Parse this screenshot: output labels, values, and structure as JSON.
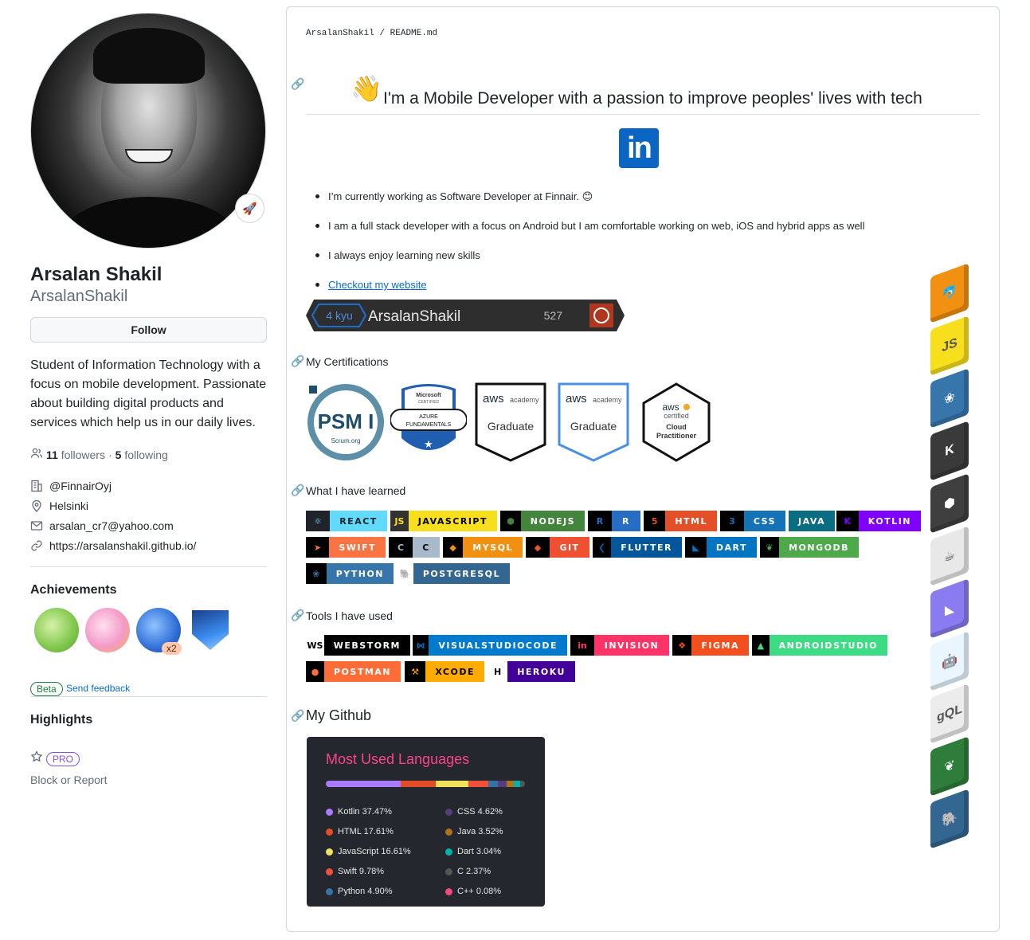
{
  "profile": {
    "name": "Arsalan Shakil",
    "login": "ArsalanShakil",
    "follow_label": "Follow",
    "bio": "Student of Information Technology with a focus on mobile development. Passionate about building digital products and services which help us in our daily lives.",
    "followers_count": "11",
    "followers_label": "followers",
    "following_count": "5",
    "following_label": "following",
    "separator": "·",
    "company": "@FinnairOyj",
    "location": "Helsinki",
    "email": "arsalan_cr7@yahoo.com",
    "website": "https://arsalanshakil.github.io/",
    "achievements_title": "Achievements",
    "achievement_multiplier": "x2",
    "beta_label": "Beta",
    "feedback_label": "Send feedback",
    "highlights_title": "Highlights",
    "pro_label": "PRO",
    "block_label": "Block or Report"
  },
  "readme": {
    "breadcrumb_user": "ArsalanShakil",
    "breadcrumb_sep": "/",
    "breadcrumb_file": "README.md",
    "wave_emoji": "👋",
    "headline": "I'm a Mobile Developer with a passion to improve peoples' lives with tech",
    "linkedin_label": "in",
    "bullets": [
      "I’m currently working as Software Developer at Finnair. 😊",
      "I am a full stack developer with a focus on Android but I am comfortable working on web, iOS and hybrid apps as well",
      "I always enjoy learning new skills"
    ],
    "website_link": "Checkout my website",
    "codewars": {
      "rank": "4 kyu",
      "user": "ArsalanShakil",
      "score": "527"
    },
    "certifications_title": "My Certifications",
    "certs": {
      "psm": "PSM I",
      "psm_org": "Scrum.org",
      "azure_ms": "Microsoft",
      "azure_certified": "CERTIFIED",
      "azure_name1": "AZURE",
      "azure_name2": "FUNDAMENTALS",
      "aws": "aws",
      "aws_academy": "academy",
      "aws_graduate": "Graduate",
      "aws_certified": "certified",
      "aws_cloud": "Cloud",
      "aws_practitioner": "Practitioner"
    },
    "learned_title": "What I have learned",
    "learned": [
      {
        "label": "REACT",
        "logo": "⚛",
        "logo_bg": "#20232a",
        "bg": "#61dafb",
        "fg": "#20232a"
      },
      {
        "label": "JAVASCRIPT",
        "logo": "JS",
        "logo_bg": "#323330",
        "bg": "#f7df1e",
        "fg": "#000000"
      },
      {
        "label": "NODEJS",
        "logo": "⬢",
        "logo_bg": "#000000",
        "bg": "#43853d",
        "fg": "#ffffff"
      },
      {
        "label": "R",
        "logo": "R",
        "logo_bg": "#000000",
        "bg": "#276dc3",
        "fg": "#ffffff"
      },
      {
        "label": "HTML",
        "logo": "5",
        "logo_bg": "#000000",
        "bg": "#e34f26",
        "fg": "#ffffff"
      },
      {
        "label": "CSS",
        "logo": "3",
        "logo_bg": "#000000",
        "bg": "#1572b6",
        "fg": "#ffffff"
      },
      {
        "label": "JAVA",
        "logo": "",
        "logo_bg": "#0a6d82",
        "bg": "#0a6d82",
        "fg": "#ffffff"
      },
      {
        "label": "KOTLIN",
        "logo": "K",
        "logo_bg": "#000000",
        "bg": "#7f00ff",
        "fg": "#ffffff"
      },
      {
        "label": "SWIFT",
        "logo": "➤",
        "logo_bg": "#000000",
        "bg": "#fa7343",
        "fg": "#ffffff"
      },
      {
        "label": "C",
        "logo": "C",
        "logo_bg": "#000000",
        "bg": "#a8b9cc",
        "fg": "#000000"
      },
      {
        "label": "MYSQL",
        "logo": "◆",
        "logo_bg": "#000000",
        "bg": "#f29111",
        "fg": "#ffffff"
      },
      {
        "label": "GIT",
        "logo": "◆",
        "logo_bg": "#000000",
        "bg": "#f05032",
        "fg": "#ffffff"
      },
      {
        "label": "FLUTTER",
        "logo": "❮",
        "logo_bg": "#000000",
        "bg": "#02569b",
        "fg": "#ffffff"
      },
      {
        "label": "DART",
        "logo": "◣",
        "logo_bg": "#000000",
        "bg": "#0175c2",
        "fg": "#ffffff"
      },
      {
        "label": "MONGODB",
        "logo": "❦",
        "logo_bg": "#000000",
        "bg": "#4ea94b",
        "fg": "#ffffff"
      },
      {
        "label": "PYTHON",
        "logo": "❀",
        "logo_bg": "#000000",
        "bg": "#3776ab",
        "fg": "#ffffff"
      },
      {
        "label": "POSTGRESQL",
        "logo": "🐘",
        "logo_bg": "#ffffff",
        "bg": "#336791",
        "fg": "#ffffff"
      }
    ],
    "tools_title": "Tools I have used",
    "tools": [
      {
        "label": "WEBSTORM",
        "logo": "WS",
        "logo_bg": "#ffffff",
        "bg": "#000000",
        "fg": "#ffffff"
      },
      {
        "label": "VISUALSTUDIOCODE",
        "logo": "⋈",
        "logo_bg": "#000000",
        "bg": "#007acc",
        "fg": "#ffffff"
      },
      {
        "label": "INVISION",
        "logo": "in",
        "logo_bg": "#000000",
        "bg": "#ff3366",
        "fg": "#ffffff"
      },
      {
        "label": "FIGMA",
        "logo": "❖",
        "logo_bg": "#000000",
        "bg": "#f24e1e",
        "fg": "#ffffff"
      },
      {
        "label": "ANDROIDSTUDIO",
        "logo": "▲",
        "logo_bg": "#000000",
        "bg": "#3ddc84",
        "fg": "#ffffff"
      },
      {
        "label": "POSTMAN",
        "logo": "●",
        "logo_bg": "#000000",
        "bg": "#ff6c37",
        "fg": "#ffffff"
      },
      {
        "label": "XCODE",
        "logo": "⚒",
        "logo_bg": "#000000",
        "bg": "#ffab00",
        "fg": "#000000"
      },
      {
        "label": "HEROKU",
        "logo": "H",
        "logo_bg": "#ffffff",
        "bg": "#430098",
        "fg": "#ffffff"
      }
    ],
    "github_title": "My Github",
    "languages_card": {
      "title": "Most Used Languages",
      "items": [
        {
          "name": "Kotlin",
          "percent": 37.47,
          "label": "Kotlin 37.47%",
          "color": "#a97bff"
        },
        {
          "name": "HTML",
          "percent": 17.61,
          "label": "HTML 17.61%",
          "color": "#e34c26"
        },
        {
          "name": "JavaScript",
          "percent": 16.61,
          "label": "JavaScript 16.61%",
          "color": "#f1e05a"
        },
        {
          "name": "Swift",
          "percent": 9.78,
          "label": "Swift 9.78%",
          "color": "#f05138"
        },
        {
          "name": "Python",
          "percent": 4.9,
          "label": "Python 4.90%",
          "color": "#3572a5"
        },
        {
          "name": "CSS",
          "percent": 4.62,
          "label": "CSS 4.62%",
          "color": "#563d7c"
        },
        {
          "name": "Java",
          "percent": 3.52,
          "label": "Java 3.52%",
          "color": "#b07219"
        },
        {
          "name": "Dart",
          "percent": 3.04,
          "label": "Dart 3.04%",
          "color": "#00b4ab"
        },
        {
          "name": "C",
          "percent": 2.37,
          "label": "C 2.37%",
          "color": "#555555"
        },
        {
          "name": "C++",
          "percent": 0.08,
          "label": "C++ 0.08%",
          "color": "#f34b7d"
        }
      ]
    },
    "stack_icons": [
      {
        "name": "mysql-icon",
        "color": "#f29111",
        "glyph": "🐬"
      },
      {
        "name": "javascript-icon",
        "color": "#f7df1e",
        "glyph": "JS"
      },
      {
        "name": "python-icon",
        "color": "#3776ab",
        "glyph": "❀"
      },
      {
        "name": "kotlin-icon",
        "color": "#3a3a3a",
        "glyph": "K"
      },
      {
        "name": "nodejs-icon",
        "color": "#3f3f3f",
        "glyph": "⬢"
      },
      {
        "name": "java-icon",
        "color": "#e8e8e8",
        "glyph": "☕"
      },
      {
        "name": "kotlin-purple-icon",
        "color": "#8a7cf0",
        "glyph": "◣"
      },
      {
        "name": "android-icon",
        "color": "#eaf6ff",
        "glyph": "🤖"
      },
      {
        "name": "graphql-icon",
        "color": "#ececec",
        "glyph": "gQL"
      },
      {
        "name": "mongodb-icon",
        "color": "#2f7d3a",
        "glyph": "❦"
      },
      {
        "name": "postgresql-icon",
        "color": "#336791",
        "glyph": "🐘"
      }
    ]
  }
}
